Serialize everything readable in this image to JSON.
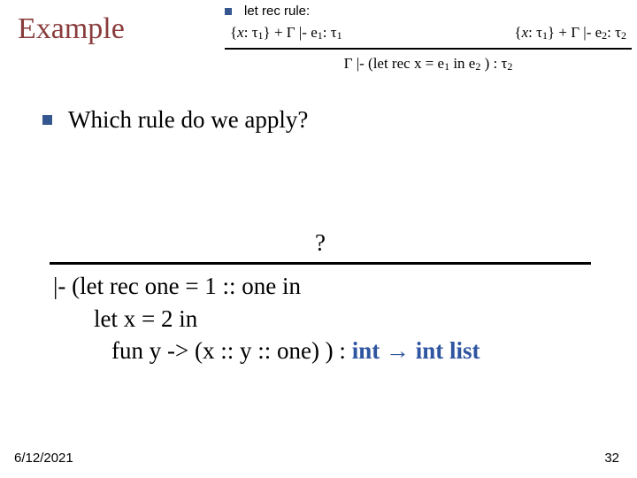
{
  "title": "Example",
  "rule": {
    "label": "let rec rule:",
    "premise1": "{x: τ₁} + Γ |- e₁: τ₁",
    "premise2": "{x: τ₁} + Γ |- e₂: τ₂",
    "conclusion": "Γ |- (let rec x = e₁ in e₂ ) : τ₂"
  },
  "question": "Which rule do we apply?",
  "proof": {
    "mark": "?",
    "line1": "|- (let rec one = 1 :: one in",
    "line2": "let x = 2 in",
    "line3_prefix": "fun y -> (x :: y :: one) ) : ",
    "type_left": "int",
    "arrow": " → ",
    "type_right": "int list"
  },
  "footer": {
    "date": "6/12/2021",
    "page": "32"
  }
}
